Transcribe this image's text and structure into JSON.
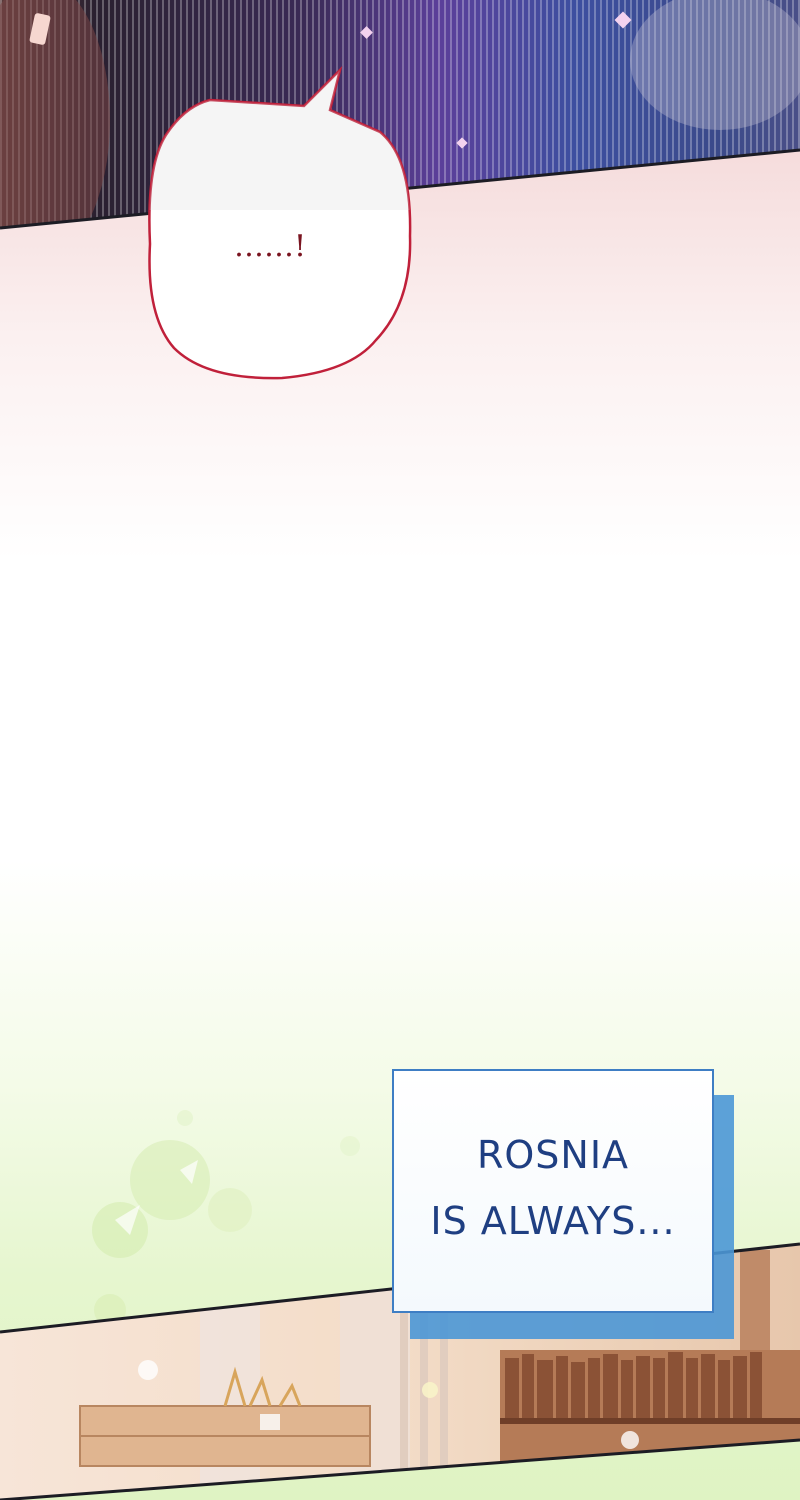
{
  "speech_bubble": {
    "text": "……!"
  },
  "caption": {
    "line1": "ROSNIA",
    "line2": "IS ALWAYS..."
  },
  "colors": {
    "bubble_border": "#c0203a",
    "caption_text": "#1f3f82",
    "caption_border": "#3e7ec4",
    "caption_shadow": "#4b97d6"
  },
  "icons": {
    "top_panel": "striped-night-scene",
    "bottom_panel": "library-room-scene",
    "decoration": "sparkle-icon"
  }
}
